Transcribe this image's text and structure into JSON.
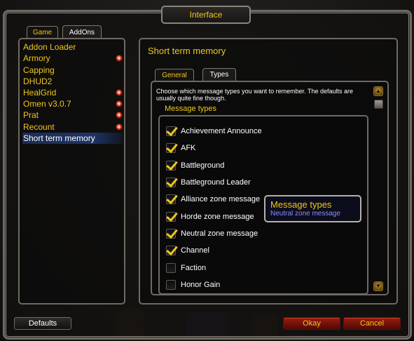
{
  "window": {
    "title": "Interface"
  },
  "top_tabs": [
    {
      "label": "Game",
      "active": false
    },
    {
      "label": "AddOns",
      "active": true
    }
  ],
  "addons": [
    {
      "label": "Addon Loader",
      "expandable": false,
      "selected": false
    },
    {
      "label": "Armory",
      "expandable": true,
      "selected": false
    },
    {
      "label": "Capping",
      "expandable": false,
      "selected": false
    },
    {
      "label": "DHUD2",
      "expandable": false,
      "selected": false
    },
    {
      "label": "HealGrid",
      "expandable": true,
      "selected": false
    },
    {
      "label": "Omen v3.0.7",
      "expandable": true,
      "selected": false
    },
    {
      "label": "Prat",
      "expandable": true,
      "selected": false
    },
    {
      "label": "Recount",
      "expandable": true,
      "selected": false
    },
    {
      "label": "Short term memory",
      "expandable": false,
      "selected": true
    }
  ],
  "expand_glyph": "+",
  "main": {
    "title": "Short term memory",
    "tabs": [
      {
        "label": "General",
        "active": false
      },
      {
        "label": "Types",
        "active": true
      }
    ],
    "description": "Choose which message types you want to remember. The defaults are usually quite fine though.",
    "section_title": "Message types",
    "options": [
      {
        "label": "Achievement Announce",
        "checked": true
      },
      {
        "label": "AFK",
        "checked": true
      },
      {
        "label": "Battleground",
        "checked": true
      },
      {
        "label": "Battleground Leader",
        "checked": true
      },
      {
        "label": "Alliance zone message",
        "checked": true
      },
      {
        "label": "Horde zone message",
        "checked": true
      },
      {
        "label": "Neutral zone message",
        "checked": true
      },
      {
        "label": "Channel",
        "checked": true
      },
      {
        "label": "Faction",
        "checked": false
      },
      {
        "label": "Honor Gain",
        "checked": false
      }
    ]
  },
  "tooltip": {
    "title": "Message types",
    "body": "Neutral zone message"
  },
  "buttons": {
    "defaults": "Defaults",
    "okay": "Okay",
    "cancel": "Cancel"
  },
  "icons": {
    "scroll_up": "scroll-up-icon",
    "scroll_down": "scroll-down-icon",
    "expand": "plus-icon",
    "check": "checkmark-icon"
  },
  "colors": {
    "accent_gold": "#f0c61b",
    "button_red": "#9b1c10",
    "selection_blue": "#1f3466",
    "tooltip_text": "#8d8cff"
  }
}
